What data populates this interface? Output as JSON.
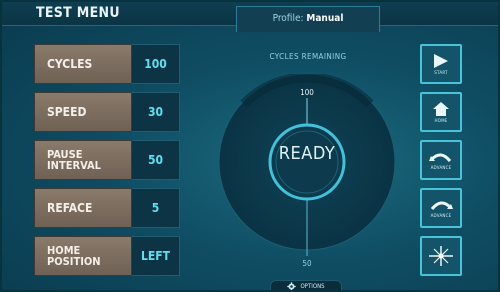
{
  "header": {
    "menu_title": "TEST MENU",
    "profile_label": "Profile:",
    "profile_value": "Manual"
  },
  "params": [
    {
      "label": "CYCLES",
      "value": "100"
    },
    {
      "label": "SPEED",
      "value": "30"
    },
    {
      "label": "PAUSE INTERVAL",
      "value": "50"
    },
    {
      "label": "REFACE",
      "value": "5"
    },
    {
      "label": "HOME POSITION",
      "value": "LEFT"
    }
  ],
  "gauge": {
    "caption": "CYCLES REMAINING",
    "top_label": "100",
    "bottom_label": "50",
    "status": "READY"
  },
  "options": {
    "label": "OPTIONS"
  },
  "side_buttons": [
    {
      "icon": "play-icon",
      "caption": "START"
    },
    {
      "icon": "home-icon",
      "caption": "HOME"
    },
    {
      "icon": "advance-left-icon",
      "caption": "ADVANCE"
    },
    {
      "icon": "advance-right-icon",
      "caption": "ADVANCE"
    },
    {
      "icon": "light-icon",
      "caption": ""
    }
  ],
  "colors": {
    "accent": "#48c4d9",
    "value_text": "#5fe0ef",
    "label_bg": "#8a7a6a",
    "background": "#0f4d63"
  }
}
